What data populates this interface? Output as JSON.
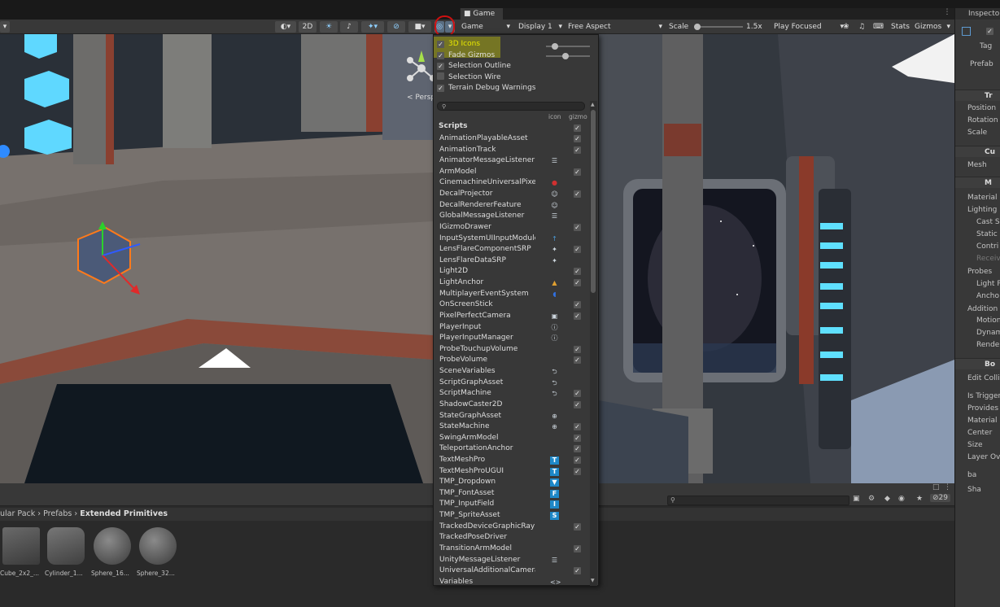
{
  "game_view": {
    "tab_label": "Game",
    "mode": "Game",
    "display": "Display 1",
    "aspect": "Free Aspect",
    "scale_label": "Scale",
    "scale_value": "1.5x",
    "play_mode": "Play Focused",
    "stats_label": "Stats",
    "gizmos_label": "Gizmos"
  },
  "scene_toolbar": {
    "toggle_2d": "2D",
    "perspective_label": "< Persp"
  },
  "gizmos_dropdown": {
    "options": [
      {
        "label": "3D Icons",
        "checked": true
      },
      {
        "label": "Fade Gizmos",
        "checked": true
      },
      {
        "label": "Selection Outline",
        "checked": true
      },
      {
        "label": "Selection Wire",
        "checked": false
      },
      {
        "label": "Terrain Debug Warnings",
        "checked": true
      }
    ],
    "column_icon": "icon",
    "column_gizmo": "gizmo",
    "section_scripts": "Scripts",
    "scripts": [
      {
        "name": "AnimationPlayableAsset",
        "icon": "",
        "gizmo": true
      },
      {
        "name": "AnimationTrack",
        "icon": "",
        "gizmo": true
      },
      {
        "name": "AnimatorMessageListener",
        "icon": "script-icon",
        "gizmo": false
      },
      {
        "name": "ArmModel",
        "icon": "",
        "gizmo": true
      },
      {
        "name": "CinemachineUniversalPixe",
        "icon": "red-icon",
        "gizmo": false
      },
      {
        "name": "DecalProjector",
        "icon": "person-icon",
        "gizmo": true
      },
      {
        "name": "DecalRendererFeature",
        "icon": "person-icon",
        "gizmo": false
      },
      {
        "name": "GlobalMessageListener",
        "icon": "script-icon",
        "gizmo": false
      },
      {
        "name": "IGizmoDrawer",
        "icon": "",
        "gizmo": true
      },
      {
        "name": "InputSystemUIInputModule",
        "icon": "input-icon",
        "gizmo": false
      },
      {
        "name": "LensFlareComponentSRP",
        "icon": "flare-icon",
        "gizmo": true
      },
      {
        "name": "LensFlareDataSRP",
        "icon": "flare-icon",
        "gizmo": false
      },
      {
        "name": "Light2D",
        "icon": "",
        "gizmo": true
      },
      {
        "name": "LightAnchor",
        "icon": "anchor-icon",
        "gizmo": true
      },
      {
        "name": "MultiplayerEventSystem",
        "icon": "event-icon",
        "gizmo": false
      },
      {
        "name": "OnScreenStick",
        "icon": "",
        "gizmo": true
      },
      {
        "name": "PixelPerfectCamera",
        "icon": "camera-icon",
        "gizmo": true
      },
      {
        "name": "PlayerInput",
        "icon": "info-icon",
        "gizmo": false
      },
      {
        "name": "PlayerInputManager",
        "icon": "info-icon",
        "gizmo": false
      },
      {
        "name": "ProbeTouchupVolume",
        "icon": "",
        "gizmo": true
      },
      {
        "name": "ProbeVolume",
        "icon": "",
        "gizmo": true
      },
      {
        "name": "SceneVariables",
        "icon": "graph-icon",
        "gizmo": false
      },
      {
        "name": "ScriptGraphAsset",
        "icon": "graph-icon",
        "gizmo": false
      },
      {
        "name": "ScriptMachine",
        "icon": "graph-icon",
        "gizmo": true
      },
      {
        "name": "ShadowCaster2D",
        "icon": "",
        "gizmo": true
      },
      {
        "name": "StateGraphAsset",
        "icon": "state-icon",
        "gizmo": false
      },
      {
        "name": "StateMachine",
        "icon": "state-icon",
        "gizmo": true
      },
      {
        "name": "SwingArmModel",
        "icon": "",
        "gizmo": true
      },
      {
        "name": "TeleportationAnchor",
        "icon": "",
        "gizmo": true
      },
      {
        "name": "TextMeshPro",
        "icon": "tmp-text-icon",
        "gizmo": true
      },
      {
        "name": "TextMeshProUGUI",
        "icon": "tmp-text-icon",
        "gizmo": true
      },
      {
        "name": "TMP_Dropdown",
        "icon": "tmp-dropdown-icon",
        "gizmo": false
      },
      {
        "name": "TMP_FontAsset",
        "icon": "tmp-font-icon",
        "gizmo": false
      },
      {
        "name": "TMP_InputField",
        "icon": "tmp-input-icon",
        "gizmo": false
      },
      {
        "name": "TMP_SpriteAsset",
        "icon": "tmp-sprite-icon",
        "gizmo": false
      },
      {
        "name": "TrackedDeviceGraphicRay",
        "icon": "",
        "gizmo": true
      },
      {
        "name": "TrackedPoseDriver",
        "icon": "",
        "gizmo": false
      },
      {
        "name": "TransitionArmModel",
        "icon": "",
        "gizmo": true
      },
      {
        "name": "UnityMessageListener",
        "icon": "script-icon",
        "gizmo": false
      },
      {
        "name": "UniversalAdditionalCamera",
        "icon": "",
        "gizmo": true
      },
      {
        "name": "Variables",
        "icon": "code-icon",
        "gizmo": false
      }
    ]
  },
  "inspector": {
    "tab_label": "Inspecto",
    "tag_label": "Tag",
    "prefab_label": "Prefab",
    "rows": [
      {
        "label": "Tr",
        "header": true
      },
      {
        "label": "Position"
      },
      {
        "label": "Rotation"
      },
      {
        "label": "Scale"
      },
      {
        "label": "Cu",
        "header": true
      },
      {
        "label": "Mesh"
      },
      {
        "label": "M",
        "header": true
      },
      {
        "label": "Material"
      },
      {
        "label": "Lighting"
      },
      {
        "label": "Cast S"
      },
      {
        "label": "Static"
      },
      {
        "label": "Contri"
      },
      {
        "label": "Receiv"
      },
      {
        "label": "Probes"
      },
      {
        "label": "Light P"
      },
      {
        "label": "Ancho"
      },
      {
        "label": "Addition"
      },
      {
        "label": "Motion"
      },
      {
        "label": "Dynam"
      },
      {
        "label": "Rende"
      },
      {
        "label": "Bo",
        "header": true
      },
      {
        "label": "Edit Colli"
      },
      {
        "label": "Is Trigger"
      },
      {
        "label": "Provides"
      },
      {
        "label": "Material"
      },
      {
        "label": "Center"
      },
      {
        "label": "Size"
      },
      {
        "label": "Layer Ov"
      },
      {
        "label": "ba"
      },
      {
        "label": "Sha"
      }
    ]
  },
  "project": {
    "breadcrumb": [
      "ular Pack",
      "Prefabs",
      "Extended Primitives"
    ],
    "hidden_count": "29",
    "assets": [
      "Cube_2x2_...",
      "Cylinder_1...",
      "Sphere_16...",
      "Sphere_32..."
    ]
  },
  "colors": {
    "highlight": "#e8e800",
    "panel": "#383838",
    "accent_red": "#d01010"
  }
}
